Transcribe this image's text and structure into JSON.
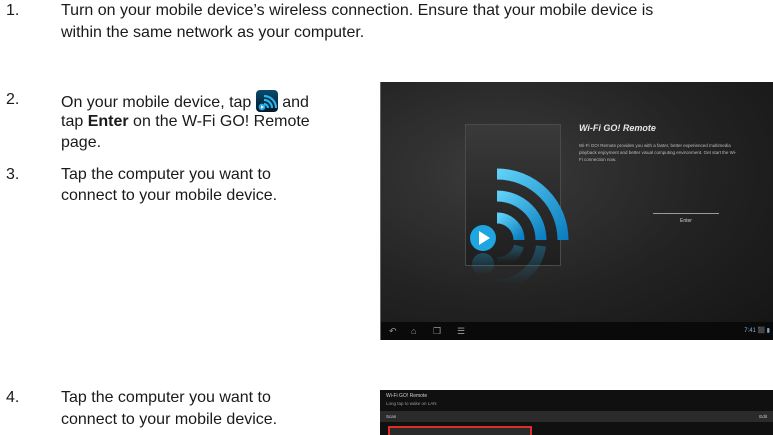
{
  "steps": [
    {
      "number": "1.",
      "line1": "Turn on your mobile device’s wireless connection. Ensure that your mobile device is",
      "line2": "within the same network as your computer."
    },
    {
      "number": "2.",
      "pre": "On your mobile device, tap ",
      "post": " and",
      "line2_pre": "tap ",
      "line2_bold": "Enter",
      "line2_post": " on the W-Fi GO! Remote",
      "line3": "page."
    },
    {
      "number": "3.",
      "line1": "Tap the computer you want to",
      "line2": "connect to your mobile device."
    },
    {
      "number": "4.",
      "line1": "Tap the computer you want to",
      "line2": "connect to your mobile device."
    }
  ],
  "inline_icon": "wifi-go-app-icon",
  "screenshot1": {
    "title": "Wi-Fi GO! Remote",
    "description": "Wi-Fi GO! Remote provides you with a faster, better experienced multimedia playback enjoyment and better visual computing environment. Get start the Wi-Fi connection now.",
    "enter_button": "Enter",
    "status": "7:41 ⬛ ▮",
    "nav_icons": [
      "back-icon",
      "home-icon",
      "recent-apps-icon",
      "menu-icon"
    ]
  },
  "screenshot2": {
    "header": "Wi-Fi GO! Remote",
    "subheader": "Long tap to wake on LAN",
    "scan_label": "Scan",
    "action_label": "Edit"
  },
  "colors": {
    "accent_blue": "#1fa5e0",
    "highlight_red": "#d9302a"
  }
}
